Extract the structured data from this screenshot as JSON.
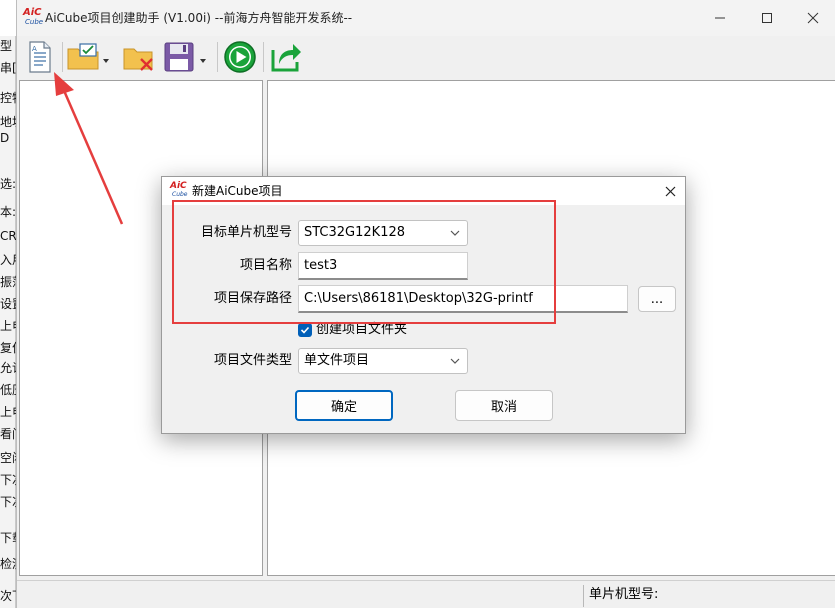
{
  "app": {
    "title": "AiCube项目创建助手 (V1.00i) --前海方舟智能开发系统--",
    "logo_text_top": "AiC",
    "logo_text_bottom": "Cube"
  },
  "background_fragments": [
    "型",
    "串[",
    "控特",
    "地址",
    "D",
    "",
    "选:",
    "本:",
    "CRC",
    "入用",
    "振荡",
    "设置",
    "上电",
    "复位",
    "允许",
    "低压",
    "上电",
    "看门",
    "空闲",
    "下次",
    "下次",
    "",
    "下载",
    "检测",
    "",
    "次下"
  ],
  "toolbar": {
    "new_icon": "new-document-icon",
    "open_icon": "open-folder-icon",
    "close_icon": "close-project-icon",
    "save_icon": "save-icon",
    "run_icon": "run-icon",
    "export_icon": "export-icon"
  },
  "status_bar": {
    "mcu_label": "单片机型号:"
  },
  "dialog": {
    "title": "新建AiCube项目",
    "mcu_label": "目标单片机型号",
    "mcu_value": "STC32G12K128",
    "name_label": "项目名称",
    "name_value": "test3",
    "path_label": "项目保存路径",
    "path_value": "C:\\Users\\86181\\Desktop\\32G-printf",
    "browse_label": "...",
    "create_folder_label": "创建项目文件夹",
    "create_folder_checked": true,
    "type_label": "项目文件类型",
    "type_value": "单文件项目",
    "ok_label": "确定",
    "cancel_label": "取消"
  },
  "colors": {
    "accent": "#0067c0",
    "annotation": "#e53e3e",
    "run_green": "#1aa33a"
  }
}
